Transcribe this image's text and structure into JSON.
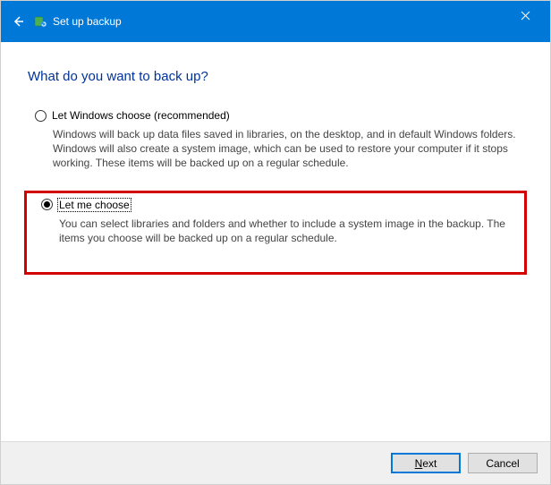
{
  "titlebar": {
    "title": "Set up backup"
  },
  "heading": "What do you want to back up?",
  "options": {
    "windows_choose": {
      "label": "Let Windows choose (recommended)",
      "description": "Windows will back up data files saved in libraries, on the desktop, and in default Windows folders. Windows will also create a system image, which can be used to restore your computer if it stops working. These items will be backed up on a regular schedule.",
      "selected": false
    },
    "let_me_choose": {
      "label": "Let me choose",
      "description": "You can select libraries and folders and whether to include a system image in the backup. The items you choose will be backed up on a regular schedule.",
      "selected": true
    }
  },
  "buttons": {
    "next_prefix": "N",
    "next_rest": "ext",
    "cancel": "Cancel"
  }
}
